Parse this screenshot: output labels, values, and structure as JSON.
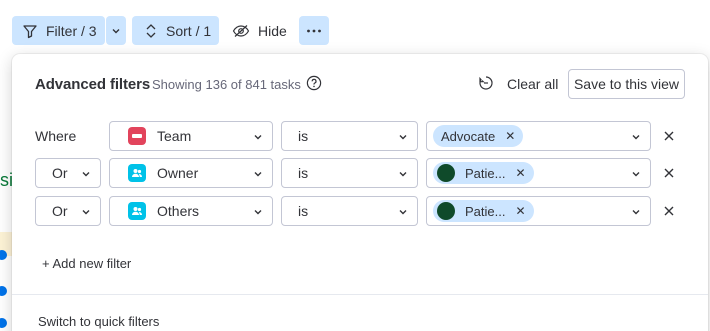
{
  "toolbar": {
    "filter_label": "Filter / 3",
    "sort_label": "Sort / 1",
    "hide_label": "Hide"
  },
  "background": {
    "partial_text": "sig"
  },
  "panel": {
    "title": "Advanced filters",
    "subtitle": "Showing 136 of 841 tasks",
    "clear_all": "Clear all",
    "save_view": "Save to this view",
    "add_filter": "+ Add new filter",
    "switch_quick": "Switch to quick filters"
  },
  "filters": [
    {
      "condition": "Where",
      "column": "Team",
      "column_icon": "status-column-icon",
      "column_color": "#e2445c",
      "operator": "is",
      "value": "Advocate",
      "value_type": "label"
    },
    {
      "condition": "Or",
      "column": "Owner",
      "column_icon": "people-column-icon",
      "column_color": "#00c2e8",
      "operator": "is",
      "value": "Patie...",
      "value_type": "person"
    },
    {
      "condition": "Or",
      "column": "Others",
      "column_icon": "people-column-icon",
      "column_color": "#00c2e8",
      "operator": "is",
      "value": "Patie...",
      "value_type": "person"
    }
  ],
  "colors": {
    "accent_selected": "#cce5ff",
    "text": "#323338",
    "border": "#c3c6d4",
    "avatar": "#0f4a2a"
  }
}
